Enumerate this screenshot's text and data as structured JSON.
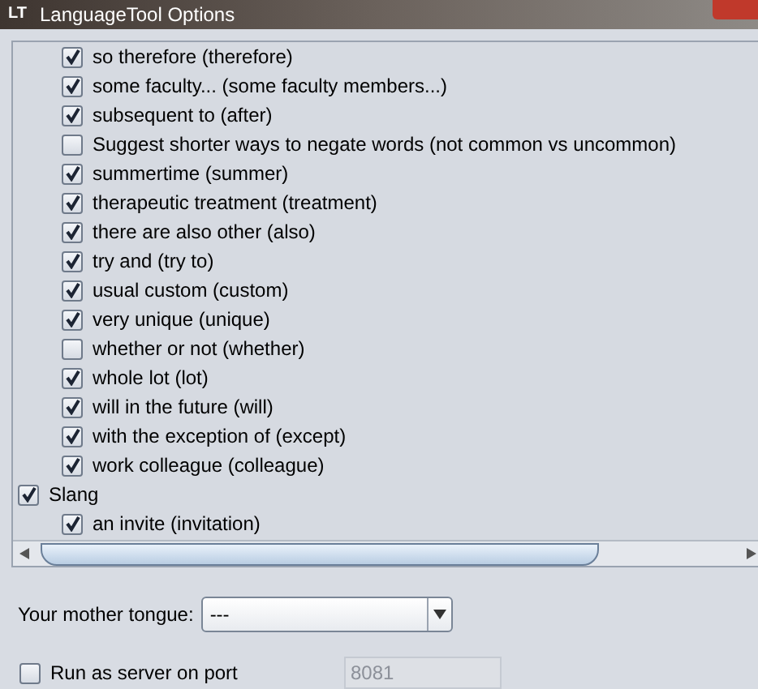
{
  "window": {
    "logo": "LT",
    "title": "LanguageTool Options"
  },
  "tree": [
    {
      "children": [
        {
          "label": "so therefore (therefore)",
          "checked": true
        },
        {
          "label": "some faculty...  (some faculty members...)",
          "checked": true
        },
        {
          "label": "subsequent to (after)",
          "checked": true
        },
        {
          "label": "Suggest shorter ways to negate words (not common vs uncommon)",
          "checked": false
        },
        {
          "label": "summertime (summer)",
          "checked": true
        },
        {
          "label": "therapeutic treatment (treatment)",
          "checked": true
        },
        {
          "label": "there are also other (also)",
          "checked": true
        },
        {
          "label": "try and (try to)",
          "checked": true
        },
        {
          "label": "usual custom (custom)",
          "checked": true
        },
        {
          "label": "very unique (unique)",
          "checked": true
        },
        {
          "label": "whether or not (whether)",
          "checked": false
        },
        {
          "label": "whole lot (lot)",
          "checked": true
        },
        {
          "label": "will in the future (will)",
          "checked": true
        },
        {
          "label": "with the exception of (except)",
          "checked": true
        },
        {
          "label": "work colleague (colleague)",
          "checked": true
        }
      ]
    },
    {
      "label": "Slang",
      "checked": true,
      "children": [
        {
          "label": "an invite (invitation)",
          "checked": true
        }
      ]
    }
  ],
  "mother_tongue": {
    "label": "Your mother tongue:",
    "value": "---"
  },
  "server": {
    "label": "Run as server on port",
    "checked": false,
    "port": "8081"
  }
}
